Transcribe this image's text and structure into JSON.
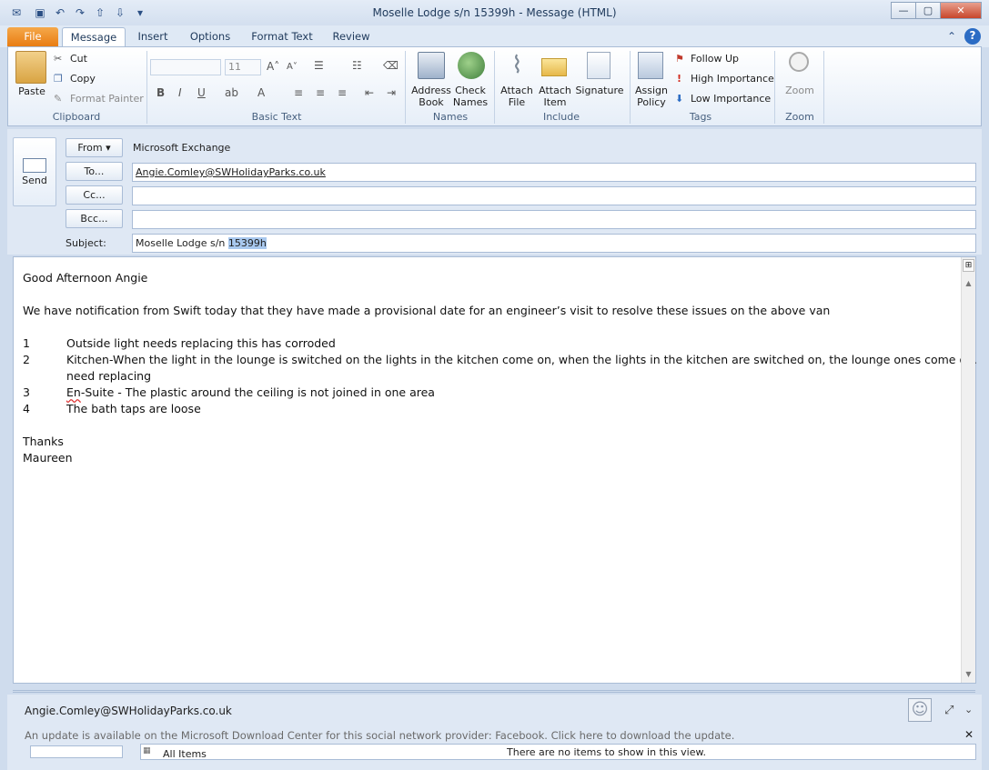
{
  "window": {
    "title": "Moselle Lodge s/n 15399h  -  Message (HTML)"
  },
  "tabs": [
    "File",
    "Message",
    "Insert",
    "Options",
    "Format Text",
    "Review"
  ],
  "ribbon": {
    "clipboard": {
      "paste": "Paste",
      "cut": "Cut",
      "copy": "Copy",
      "format_painter": "Format Painter",
      "label": "Clipboard"
    },
    "basic_text": {
      "font_size": "11",
      "label": "Basic Text"
    },
    "names": {
      "address_book": "Address Book",
      "check_names": "Check Names",
      "label": "Names"
    },
    "include": {
      "attach_file": "Attach File",
      "attach_item": "Attach Item",
      "signature": "Signature",
      "label": "Include"
    },
    "tags": {
      "assign_policy": "Assign Policy",
      "follow_up": "Follow Up",
      "high_importance": "High Importance",
      "low_importance": "Low Importance",
      "label": "Tags"
    },
    "zoom": {
      "zoom": "Zoom",
      "label": "Zoom"
    }
  },
  "compose": {
    "send": "Send",
    "from_btn": "From",
    "from_value": "Microsoft Exchange",
    "to_btn": "To...",
    "to_value": "Angie.Comley@SWHolidayParks.co.uk",
    "cc_btn": "Cc...",
    "bcc_btn": "Bcc...",
    "subject_label": "Subject:",
    "subject_prefix": "Moselle Lodge s/n ",
    "subject_highlight": "15399h"
  },
  "body": {
    "greeting": "Good Afternoon Angie",
    "intro": "We have notification from Swift today that they have made a provisional date for an engineer’s visit to resolve these issues on the above van",
    "items": [
      {
        "num": "1",
        "text": "Outside light needs replacing this has corroded"
      },
      {
        "num": "2",
        "text": "Kitchen-When the light in the lounge is switched on the lights in the kitchen come on, when the lights in the kitchen are switched on, the lounge ones come on.",
        "cont": "need replacing"
      },
      {
        "num": "3",
        "text_a": "En",
        "text_b": "-Suite - The plastic around the ceiling is not joined in one area"
      },
      {
        "num": "4",
        "text": "The bath taps are loose"
      }
    ],
    "thanks": "Thanks",
    "signoff": "Maureen"
  },
  "people_pane": {
    "contact": "Angie.Comley@SWHolidayParks.co.uk",
    "update_notice": "An update is available on the Microsoft Download Center for this social network provider: Facebook. Click here to download the update.",
    "all_items": "All Items",
    "no_items": "There are no items to show in this view."
  },
  "colors": {
    "file_tab": "#e87b10",
    "accent": "#2b579a",
    "highlight": "#a8c8ee"
  }
}
